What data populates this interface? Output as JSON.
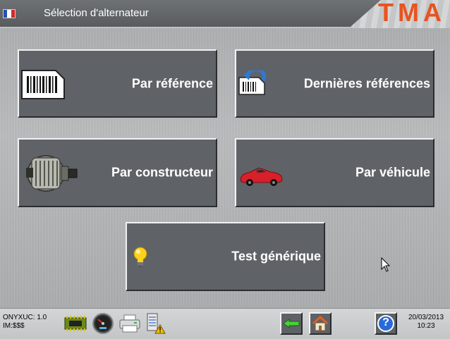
{
  "header": {
    "title": "Sélection d'alternateur",
    "logo_text": "TMA",
    "flag_colors": [
      "#2a4fb0",
      "#ffffff",
      "#d62828"
    ]
  },
  "menu": {
    "par_reference": "Par référence",
    "dernieres_references": "Dernières références",
    "par_constructeur": "Par constructeur",
    "par_vehicule": "Par véhicule",
    "test_generique": "Test générique"
  },
  "footer": {
    "device_line1": "ONYXUC: 1.0",
    "device_line2": "IM:$$$",
    "date": "20/03/2013",
    "time": "10:23",
    "help_label": "?"
  },
  "colors": {
    "button_bg": "#5f6367",
    "logo": "#e8541e",
    "car": "#d8202a"
  }
}
